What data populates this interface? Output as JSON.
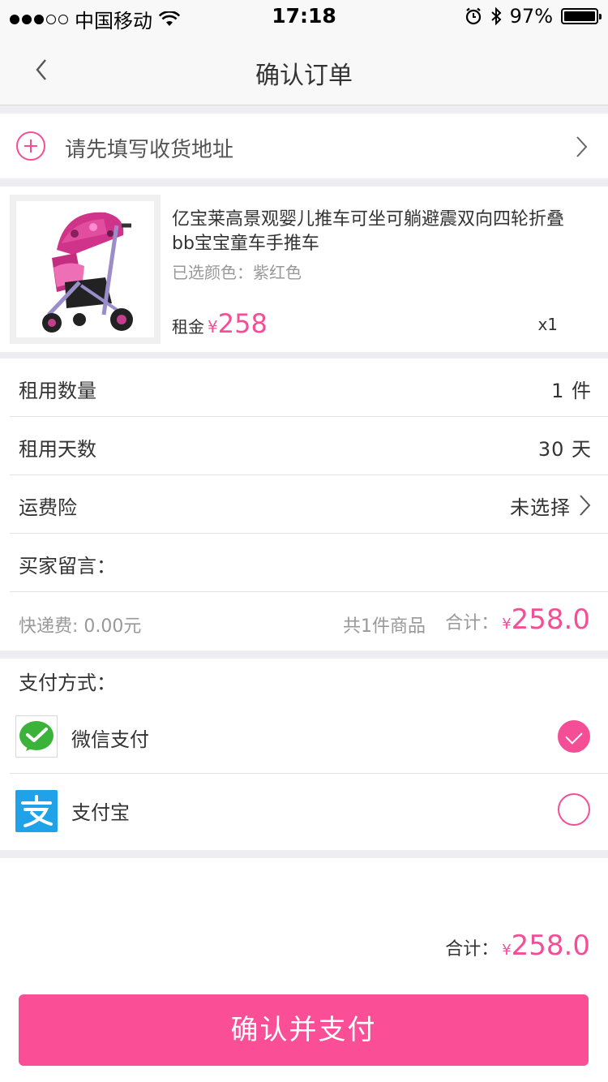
{
  "status_bar": {
    "carrier": "中国移动",
    "time": "17:18",
    "battery": "97%",
    "signal_dots": 5,
    "signal_filled": 3
  },
  "nav": {
    "title": "确认订单"
  },
  "address": {
    "prompt": "请先填写收货地址"
  },
  "product": {
    "title": "亿宝莱高景观婴儿推车可坐可躺避震双向四轮折叠bb宝宝童车手推车",
    "color": "已选颜色：紫红色",
    "price_label": "租金",
    "currency": "¥",
    "price": "258",
    "quantity": "x1"
  },
  "form": {
    "quantity_label": "租用数量",
    "quantity_value": "1 件",
    "days_label": "租用天数",
    "days_value": "30 天",
    "insurance_label": "运费险",
    "insurance_value": "未选择",
    "message_label": "买家留言："
  },
  "summary": {
    "shipping": "快递费: 0.00元",
    "item_count": "共1件商品",
    "total_label": "合计：",
    "currency": "¥",
    "total": "258.0"
  },
  "payment": {
    "title": "支付方式：",
    "methods": [
      {
        "name": "微信支付",
        "icon": "wechat-pay-icon",
        "selected": true
      },
      {
        "name": "支付宝",
        "icon": "alipay-icon",
        "selected": false
      }
    ]
  },
  "bottom": {
    "total_label": "合计：",
    "currency": "¥",
    "total": "258.0",
    "confirm_button": "确认并支付"
  },
  "colors": {
    "accent": "#f44e97",
    "button": "#fa4f97",
    "wechat": "#3bb33a",
    "alipay": "#1fa2e8"
  }
}
